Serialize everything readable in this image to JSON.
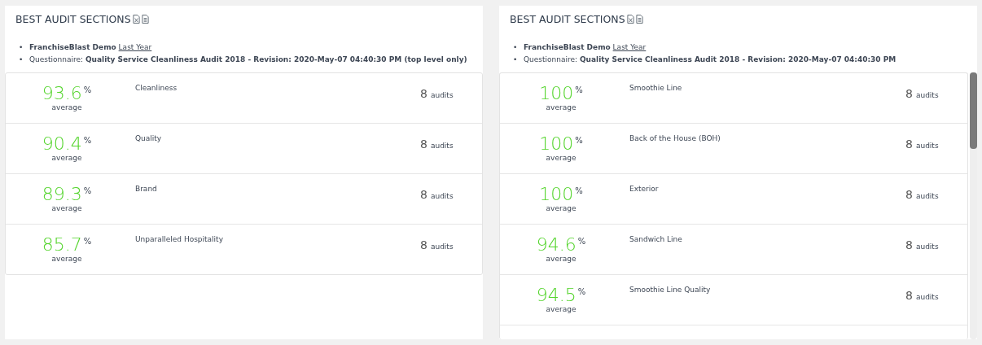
{
  "panels": [
    {
      "title": "BEST AUDIT SECTIONS",
      "scrollable": false,
      "filters": {
        "bullet": "•",
        "location": "FranchiseBlast Demo",
        "period": "Last Year",
        "questionnaire_label": "Questionnaire:",
        "questionnaire": "Quality Service Cleanliness Audit 2018 - Revision: 2020-May-07 04:40:30 PM (top level only)"
      },
      "sections": [
        {
          "score": "93.6",
          "unit": "%",
          "score_label": "average",
          "name": "Cleanliness",
          "count": "8",
          "count_label": "audits"
        },
        {
          "score": "90.4",
          "unit": "%",
          "score_label": "average",
          "name": "Quality",
          "count": "8",
          "count_label": "audits"
        },
        {
          "score": "89.3",
          "unit": "%",
          "score_label": "average",
          "name": "Brand",
          "count": "8",
          "count_label": "audits"
        },
        {
          "score": "85.7",
          "unit": "%",
          "score_label": "average",
          "name": "Unparalleled Hospitality",
          "count": "8",
          "count_label": "audits"
        }
      ]
    },
    {
      "title": "BEST AUDIT SECTIONS",
      "scrollable": true,
      "filters": {
        "bullet": "•",
        "location": "FranchiseBlast Demo",
        "period": "Last Year",
        "questionnaire_label": "Questionnaire:",
        "questionnaire": "Quality Service Cleanliness Audit 2018 - Revision: 2020-May-07 04:40:30 PM"
      },
      "sections": [
        {
          "score": "100",
          "unit": "%",
          "score_label": "average",
          "name": "Smoothie Line",
          "count": "8",
          "count_label": "audits"
        },
        {
          "score": "100",
          "unit": "%",
          "score_label": "average",
          "name": "Back of the House (BOH)",
          "count": "8",
          "count_label": "audits"
        },
        {
          "score": "100",
          "unit": "%",
          "score_label": "average",
          "name": "Exterior",
          "count": "8",
          "count_label": "audits"
        },
        {
          "score": "94.6",
          "unit": "%",
          "score_label": "average",
          "name": "Sandwich Line",
          "count": "8",
          "count_label": "audits"
        },
        {
          "score": "94.5",
          "unit": "%",
          "score_label": "average",
          "name": "Smoothie Line Quality",
          "count": "8",
          "count_label": "audits"
        }
      ]
    }
  ]
}
